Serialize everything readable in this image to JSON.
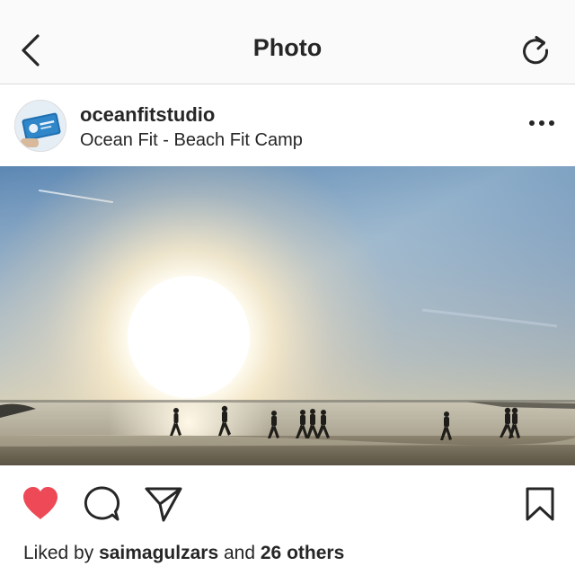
{
  "header": {
    "title": "Photo",
    "back_icon": "chevron-left-icon",
    "refresh_icon": "refresh-icon"
  },
  "post": {
    "username": "oceanfitstudio",
    "location": "Ocean Fit - Beach Fit Camp",
    "more_icon": "more-horizontal-icon",
    "photo_subject": "runners silhouetted on a beach at sunrise"
  },
  "actions": {
    "like_icon": "heart-filled-icon",
    "comment_icon": "comment-icon",
    "share_icon": "send-icon",
    "save_icon": "bookmark-icon",
    "like_color": "#ed4956"
  },
  "likes": {
    "prefix": "Liked by",
    "user": "saimagulzars",
    "middle": "and",
    "others": "26 others"
  }
}
